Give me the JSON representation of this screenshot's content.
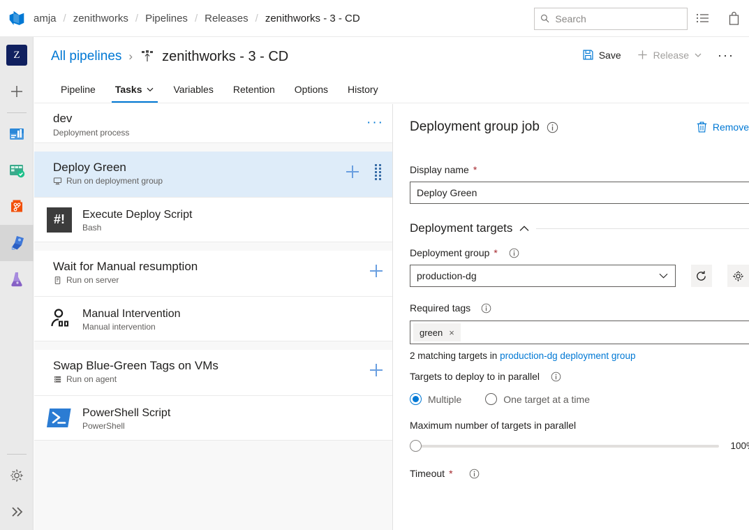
{
  "topbar": {
    "logo_icon": "azure-devops-logo",
    "breadcrumb": [
      {
        "label": "amja"
      },
      {
        "label": "zenithworks"
      },
      {
        "label": "Pipelines"
      },
      {
        "label": "Releases"
      },
      {
        "label": "zenithworks - 3 - CD"
      }
    ],
    "separator": "/",
    "search": {
      "placeholder": "Search",
      "value": "",
      "icon": "search-icon"
    },
    "actions": [
      {
        "icon": "backlog-list-icon",
        "name": "shopping-list-icon"
      },
      {
        "icon": "marketplace-bag-icon",
        "name": "marketplace-icon"
      }
    ]
  },
  "rail": {
    "org_avatar": "Z",
    "items": [
      {
        "name": "create-new-icon",
        "label": "+"
      },
      {
        "name": "overview-icon",
        "label": "Overview"
      },
      {
        "name": "boards-icon",
        "label": "Boards"
      },
      {
        "name": "repos-icon",
        "label": "Repos"
      },
      {
        "name": "pipelines-icon",
        "label": "Pipelines",
        "selected": true
      },
      {
        "name": "test-plans-icon",
        "label": "Test Plans"
      }
    ],
    "bottom": [
      {
        "name": "settings-gear-icon",
        "label": "Project settings"
      },
      {
        "name": "expand-chevrons-icon",
        "label": "Expand"
      }
    ]
  },
  "page_header": {
    "all_pipelines": "All pipelines",
    "chevron": "›",
    "pipeline_icon": "release-pipeline-icon",
    "pipeline_name": "zenithworks - 3 - CD",
    "commands": [
      {
        "label": "Save",
        "icon": "save-disk-icon",
        "disabled": false
      },
      {
        "label": "Release",
        "icon": "plus-icon",
        "disabled": true,
        "chevron": "⌄"
      },
      {
        "label": "⋯",
        "icon": "more-actions-icon",
        "disabled": false
      }
    ],
    "save_label": "Save",
    "release_label": "Release",
    "more_label": "···",
    "tabs": [
      {
        "label": "Pipeline",
        "selected": false
      },
      {
        "label": "Tasks",
        "selected": true,
        "has_chevron": true
      },
      {
        "label": "Variables",
        "selected": false
      },
      {
        "label": "Retention",
        "selected": false
      },
      {
        "label": "Options",
        "selected": false
      },
      {
        "label": "History",
        "selected": false
      }
    ]
  },
  "task_list": {
    "process": {
      "title": "dev",
      "subtitle": "Deployment process",
      "more": "···"
    },
    "groups": [
      {
        "job": {
          "title": "Deploy Green",
          "subtitle": "Run on deployment group",
          "agent_icon": "deployment-group-icon",
          "selected": true,
          "has_drag_handle": true
        },
        "tasks": [
          {
            "title": "Execute Deploy Script",
            "subtitle": "Bash",
            "icon": "bash-icon",
            "icon_text": "#!"
          }
        ]
      },
      {
        "job": {
          "title": "Wait for Manual resumption",
          "subtitle": "Run on server",
          "agent_icon": "server-icon",
          "selected": false,
          "has_drag_handle": false
        },
        "tasks": [
          {
            "title": "Manual Intervention",
            "subtitle": "Manual intervention",
            "icon": "manual-intervention-icon"
          }
        ]
      },
      {
        "job": {
          "title": "Swap Blue-Green Tags on VMs",
          "subtitle": "Run on agent",
          "agent_icon": "agent-icon",
          "selected": false,
          "has_drag_handle": false
        },
        "tasks": [
          {
            "title": "PowerShell Script",
            "subtitle": "PowerShell",
            "icon": "powershell-icon"
          }
        ]
      }
    ]
  },
  "detail": {
    "title": "Deployment group job",
    "info_icon": "info-icon",
    "remove_label": "Remove",
    "remove_icon": "trash-icon",
    "display_name_label": "Display name",
    "display_name_value": "Deploy Green",
    "section_title": "Deployment targets",
    "section_chevron": "collapse-chevron-up-icon",
    "deployment_group_label": "Deployment group",
    "deployment_group_value": "production-dg",
    "refresh_icon": "refresh-icon",
    "manage_icon": "settings-gear-icon",
    "required_tags_label": "Required tags",
    "tags": [
      {
        "label": "green",
        "remove": "×"
      }
    ],
    "matching_hint_prefix": "2 matching targets in ",
    "matching_hint_link": "production-dg deployment group",
    "parallel_label": "Targets to deploy to in parallel",
    "radio_options": [
      {
        "label": "Multiple",
        "selected": true
      },
      {
        "label": "One target at a time",
        "selected": false
      }
    ],
    "max_parallel_label": "Maximum number of targets in parallel",
    "max_parallel_value": "100%",
    "slider_position_pct": 0,
    "timeout_label": "Timeout"
  },
  "colors": {
    "accent": "#0078d4",
    "selected_row": "#deecf9",
    "required": "#a4262c",
    "bash": "#3c3c3c",
    "powershell": "#2b7cd3"
  }
}
